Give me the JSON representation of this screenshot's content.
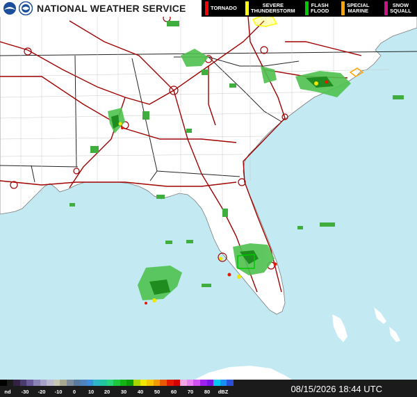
{
  "header": {
    "title": "NATIONAL WEATHER SERVICE"
  },
  "warnings": [
    {
      "label": "TORNADO",
      "color": "#ff0000"
    },
    {
      "label": "SEVERE\nTHUNDERSTORM",
      "color": "#ffff00"
    },
    {
      "label": "FLASH\nFLOOD",
      "color": "#00c800"
    },
    {
      "label": "SPECIAL\nMARINE",
      "color": "#ffa500"
    },
    {
      "label": "SNOW\nSQUALL",
      "color": "#c71585"
    }
  ],
  "reflectivity_scale": {
    "unit": "dBZ",
    "nodata_label": "nd",
    "tick_labels": [
      "-30",
      "-20",
      "-10",
      "0",
      "10",
      "20",
      "30",
      "40",
      "50",
      "60",
      "70",
      "80"
    ],
    "colors": [
      "#000000",
      "#1c1c1c",
      "#332245",
      "#4a3a70",
      "#6b5a9a",
      "#8c84b6",
      "#a7a2c8",
      "#bdb9cc",
      "#c8c6b2",
      "#a8a890",
      "#7f8a9a",
      "#5a7aa0",
      "#4d84c0",
      "#3c8ede",
      "#2eb6c8",
      "#22c4a0",
      "#28d47a",
      "#1ec83c",
      "#14b414",
      "#0c9c0c",
      "#a8d800",
      "#f0e600",
      "#f6c400",
      "#f29a00",
      "#ea5a00",
      "#e21a00",
      "#d40000",
      "#f2a8e8",
      "#e880f0",
      "#d050f0",
      "#a020f0",
      "#7a18e8",
      "#00c8f0",
      "#1890f0",
      "#2a50d8"
    ]
  },
  "timestamp": "08/15/2026 18:44 UTC",
  "map": {
    "ocean_color": "#c3e9f2",
    "land_color": "#ffffff",
    "road_color": "#a00000"
  }
}
